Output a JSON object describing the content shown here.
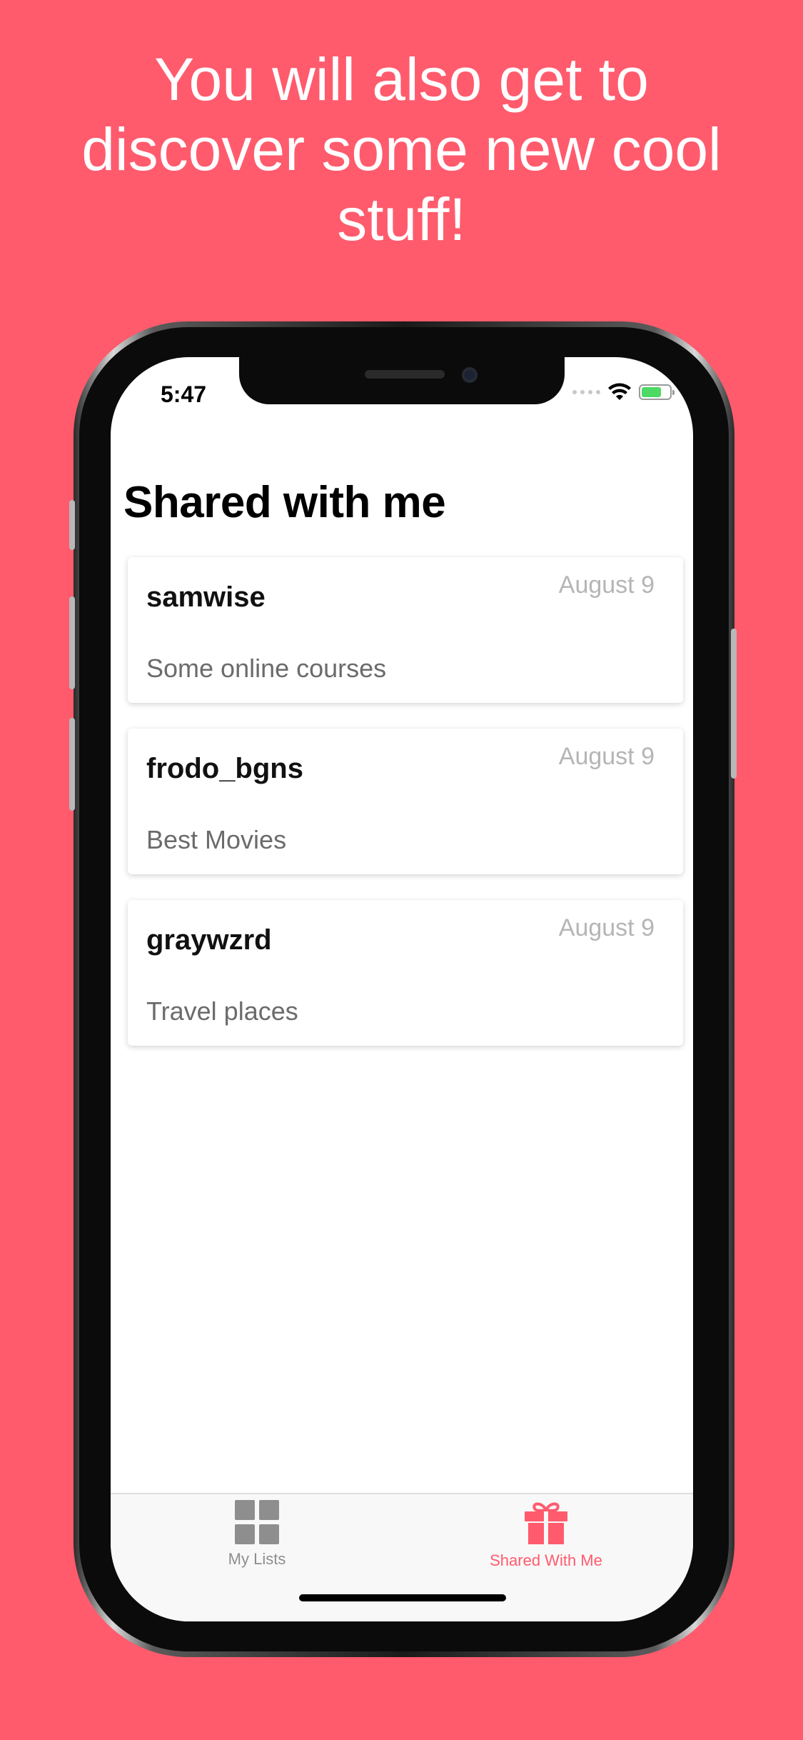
{
  "headline": {
    "line1": "You will also get to",
    "line2": "discover some new cool",
    "line3": "stuff!"
  },
  "status_bar": {
    "time": "5:47"
  },
  "page": {
    "title": "Shared with me"
  },
  "shared_lists": [
    {
      "user": "samwise",
      "date": "August 9",
      "description": "Some online courses"
    },
    {
      "user": "frodo_bgns",
      "date": "August 9",
      "description": "Best Movies"
    },
    {
      "user": "graywzrd",
      "date": "August 9",
      "description": "Travel places"
    }
  ],
  "tab_bar": {
    "items": [
      {
        "label": "My Lists",
        "icon": "grid-icon",
        "active": false
      },
      {
        "label": "Shared With Me",
        "icon": "gift-icon",
        "active": true
      }
    ]
  },
  "colors": {
    "background": "#FF5B6D",
    "accent": "#FF5B6D",
    "inactive_tab": "#8e8e8e",
    "date_text": "#b5b5b5"
  }
}
